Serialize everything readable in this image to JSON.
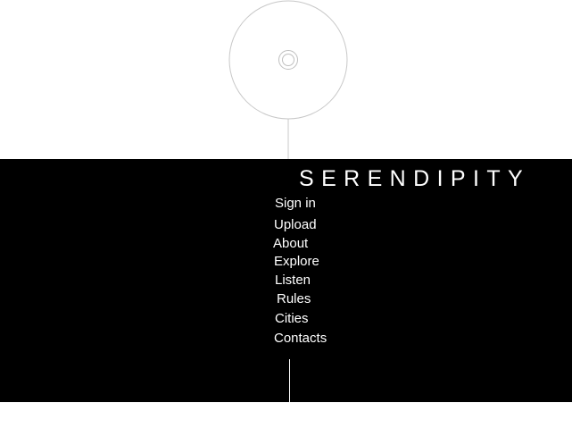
{
  "site": {
    "title": "SERENDIPITY"
  },
  "nav": {
    "items": [
      {
        "label": "Sign in"
      },
      {
        "label": "Upload"
      },
      {
        "label": "About"
      },
      {
        "label": "Explore"
      },
      {
        "label": "Listen"
      },
      {
        "label": "Rules"
      },
      {
        "label": "Cities"
      },
      {
        "label": "Contacts"
      }
    ]
  },
  "icons": {
    "disc": "vinyl-disc-icon"
  },
  "colors": {
    "panel_background": "#000000",
    "page_background": "#ffffff",
    "text": "#ffffff",
    "disc_stroke": "#cccccc"
  }
}
